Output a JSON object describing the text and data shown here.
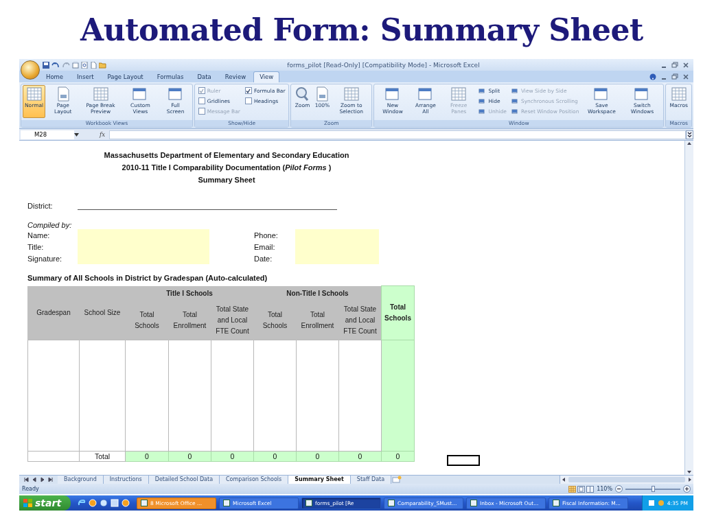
{
  "slide_title": "Automated Form: Summary Sheet",
  "window": {
    "title": "forms_pilot  [Read-Only]  [Compatibility Mode] - Microsoft Excel"
  },
  "ribbon_tabs": [
    {
      "label": "Home",
      "selected": false
    },
    {
      "label": "Insert",
      "selected": false
    },
    {
      "label": "Page Layout",
      "selected": false
    },
    {
      "label": "Formulas",
      "selected": false
    },
    {
      "label": "Data",
      "selected": false
    },
    {
      "label": "Review",
      "selected": false
    },
    {
      "label": "View",
      "selected": true
    }
  ],
  "ribbon_groups": [
    {
      "label": "Workbook Views",
      "items": [
        {
          "kind": "large",
          "label": "Normal",
          "selected": true,
          "disabled": false
        },
        {
          "kind": "large",
          "label": "Page Layout",
          "selected": false,
          "disabled": false
        },
        {
          "kind": "large",
          "label": "Page Break Preview",
          "selected": false,
          "disabled": false
        },
        {
          "kind": "large",
          "label": "Custom Views",
          "selected": false,
          "disabled": false
        },
        {
          "kind": "large",
          "label": "Full Screen",
          "selected": false,
          "disabled": false
        }
      ]
    },
    {
      "label": "Show/Hide",
      "items": [
        {
          "kind": "check",
          "label": "Ruler",
          "checked": true,
          "disabled": true
        },
        {
          "kind": "check",
          "label": "Gridlines",
          "checked": false,
          "disabled": false
        },
        {
          "kind": "check",
          "label": "Message Bar",
          "checked": false,
          "disabled": true
        },
        {
          "kind": "check",
          "label": "Formula Bar",
          "checked": true,
          "disabled": false
        },
        {
          "kind": "check",
          "label": "Headings",
          "checked": false,
          "disabled": false
        }
      ]
    },
    {
      "label": "Zoom",
      "items": [
        {
          "kind": "large",
          "label": "Zoom",
          "selected": false,
          "disabled": false
        },
        {
          "kind": "large",
          "label": "100%",
          "selected": false,
          "disabled": false
        },
        {
          "kind": "large",
          "label": "Zoom to Selection",
          "selected": false,
          "disabled": false
        }
      ]
    },
    {
      "label": "Window",
      "items": [
        {
          "kind": "large",
          "label": "New Window",
          "selected": false,
          "disabled": false
        },
        {
          "kind": "large",
          "label": "Arrange All",
          "selected": false,
          "disabled": false
        },
        {
          "kind": "large",
          "label": "Freeze Panes",
          "selected": false,
          "disabled": true
        },
        {
          "kind": "small",
          "label": "Split",
          "disabled": false
        },
        {
          "kind": "small",
          "label": "Hide",
          "disabled": false
        },
        {
          "kind": "small",
          "label": "Unhide",
          "disabled": true
        },
        {
          "kind": "small",
          "label": "View Side by Side",
          "disabled": true
        },
        {
          "kind": "small",
          "label": "Synchronous Scrolling",
          "disabled": true
        },
        {
          "kind": "small",
          "label": "Reset Window Position",
          "disabled": true
        },
        {
          "kind": "large",
          "label": "Save Workspace",
          "selected": false,
          "disabled": false
        },
        {
          "kind": "large",
          "label": "Switch Windows",
          "selected": false,
          "disabled": false
        }
      ]
    },
    {
      "label": "Macros",
      "items": [
        {
          "kind": "large",
          "label": "Macros",
          "selected": false,
          "disabled": false
        }
      ]
    }
  ],
  "formula_bar": {
    "name_box": "M28",
    "fx": "fx"
  },
  "sheet": {
    "heading_lines": [
      "Massachusetts Department of Elementary and Secondary Education",
      "2010-11 Title I Comparability Documentation (*Pilot Forms* )",
      "Summary Sheet"
    ],
    "district_label": "District:",
    "compiled_by": "Compiled by:",
    "fields_left": [
      "Name:",
      "Title:",
      "Signature:"
    ],
    "fields_right": [
      "Phone:",
      "Email:",
      "Date:"
    ],
    "summary_title": "Summary of All Schools in District by Gradespan (Auto-calculated)",
    "table": {
      "lead_columns": [
        "Gradespan",
        "School Size"
      ],
      "groups": [
        {
          "label": "Title I Schools",
          "columns": [
            "Total Schools",
            "Total Enrollment",
            "Total State and Local FTE Count"
          ]
        },
        {
          "label": "Non-Title I Schools",
          "columns": [
            "Total Schools",
            "Total Enrollment",
            "Total State and Local FTE Count"
          ]
        }
      ],
      "total_column": "Total Schools",
      "total_row": {
        "label": "Total",
        "values": [
          "0",
          "0",
          "0",
          "0",
          "0",
          "0"
        ],
        "total": "0"
      }
    }
  },
  "sheet_tabs": [
    {
      "label": "Background",
      "selected": false
    },
    {
      "label": "Instructions",
      "selected": false
    },
    {
      "label": "Detailed School Data",
      "selected": false
    },
    {
      "label": "Comparison Schools",
      "selected": false
    },
    {
      "label": "Summary Sheet",
      "selected": true
    },
    {
      "label": "Staff Data",
      "selected": false
    }
  ],
  "status_bar": {
    "text": "Ready",
    "zoom": "110%",
    "level": 0.5
  },
  "taskbar": {
    "start": "start",
    "buttons": [
      {
        "label": "8 Microsoft Office ...",
        "selected": false,
        "flashing": true
      },
      {
        "label": "Microsoft Excel",
        "selected": false,
        "flashing": false
      },
      {
        "label": "forms_pilot [Re",
        "selected": true,
        "flashing": false
      },
      {
        "label": "Comparability_SMust...",
        "selected": false,
        "flashing": false
      },
      {
        "label": "Inbox - Microsoft Out...",
        "selected": false,
        "flashing": false
      },
      {
        "label": "Fiscal Information: M...",
        "selected": false,
        "flashing": false
      }
    ],
    "clock": "4:35 PM"
  }
}
